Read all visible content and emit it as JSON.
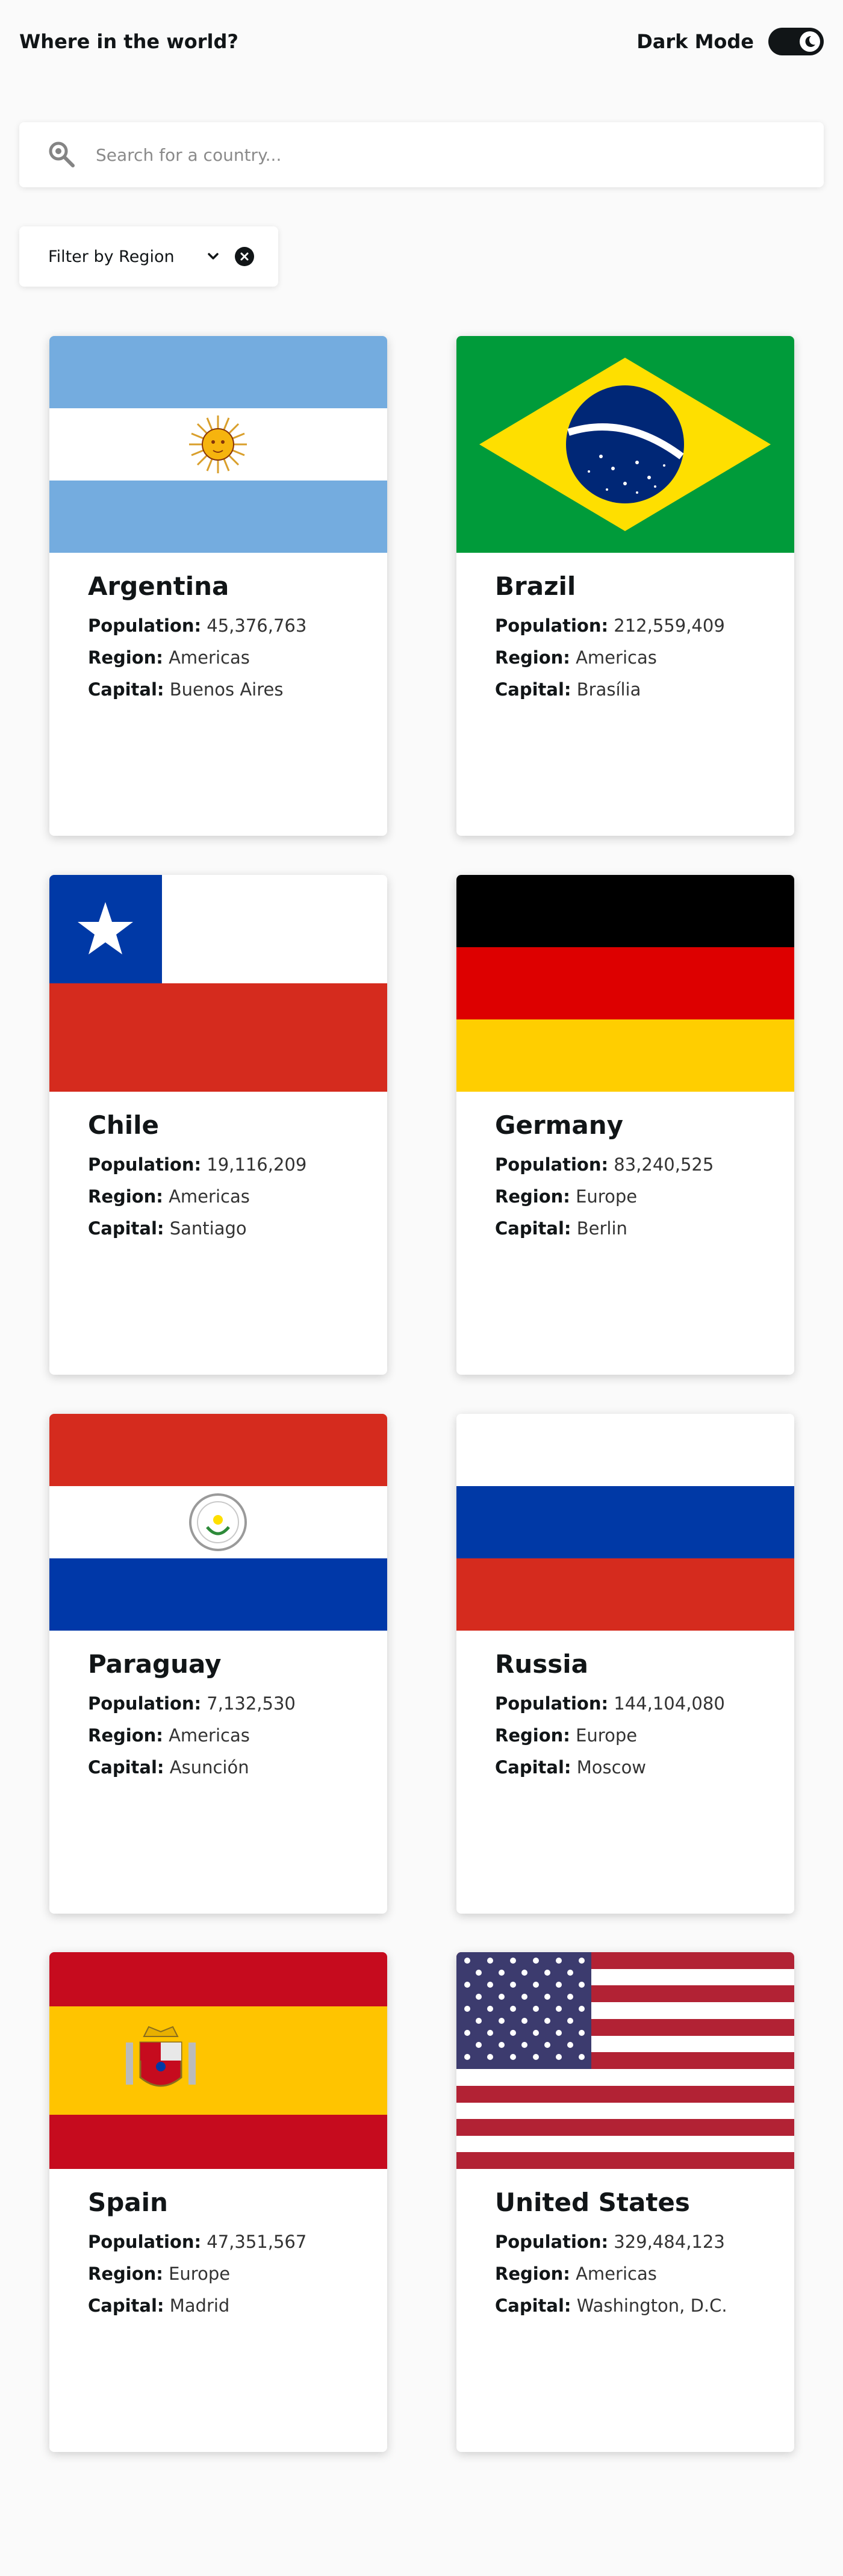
{
  "header": {
    "title": "Where in the world?",
    "dark_mode_label": "Dark Mode"
  },
  "search": {
    "placeholder": "Search for a country..."
  },
  "filter": {
    "label": "Filter by Region"
  },
  "labels": {
    "population": "Population:",
    "region": "Region:",
    "capital": "Capital:"
  },
  "countries": [
    {
      "name": "Argentina",
      "population": "45,376,763",
      "region": "Americas",
      "capital": "Buenos Aires"
    },
    {
      "name": "Brazil",
      "population": "212,559,409",
      "region": "Americas",
      "capital": "Brasília"
    },
    {
      "name": "Chile",
      "population": "19,116,209",
      "region": "Americas",
      "capital": "Santiago"
    },
    {
      "name": "Germany",
      "population": "83,240,525",
      "region": "Europe",
      "capital": "Berlin"
    },
    {
      "name": "Paraguay",
      "population": "7,132,530",
      "region": "Americas",
      "capital": "Asunción"
    },
    {
      "name": "Russia",
      "population": "144,104,080",
      "region": "Europe",
      "capital": "Moscow"
    },
    {
      "name": "Spain",
      "population": "47,351,567",
      "region": "Europe",
      "capital": "Madrid"
    },
    {
      "name": "United States",
      "population": "329,484,123",
      "region": "Americas",
      "capital": "Washington, D.C."
    }
  ],
  "icons": {
    "search": "search-icon",
    "chevron": "chevron-down-icon",
    "clear": "clear-filter-icon",
    "moon": "moon-icon"
  }
}
